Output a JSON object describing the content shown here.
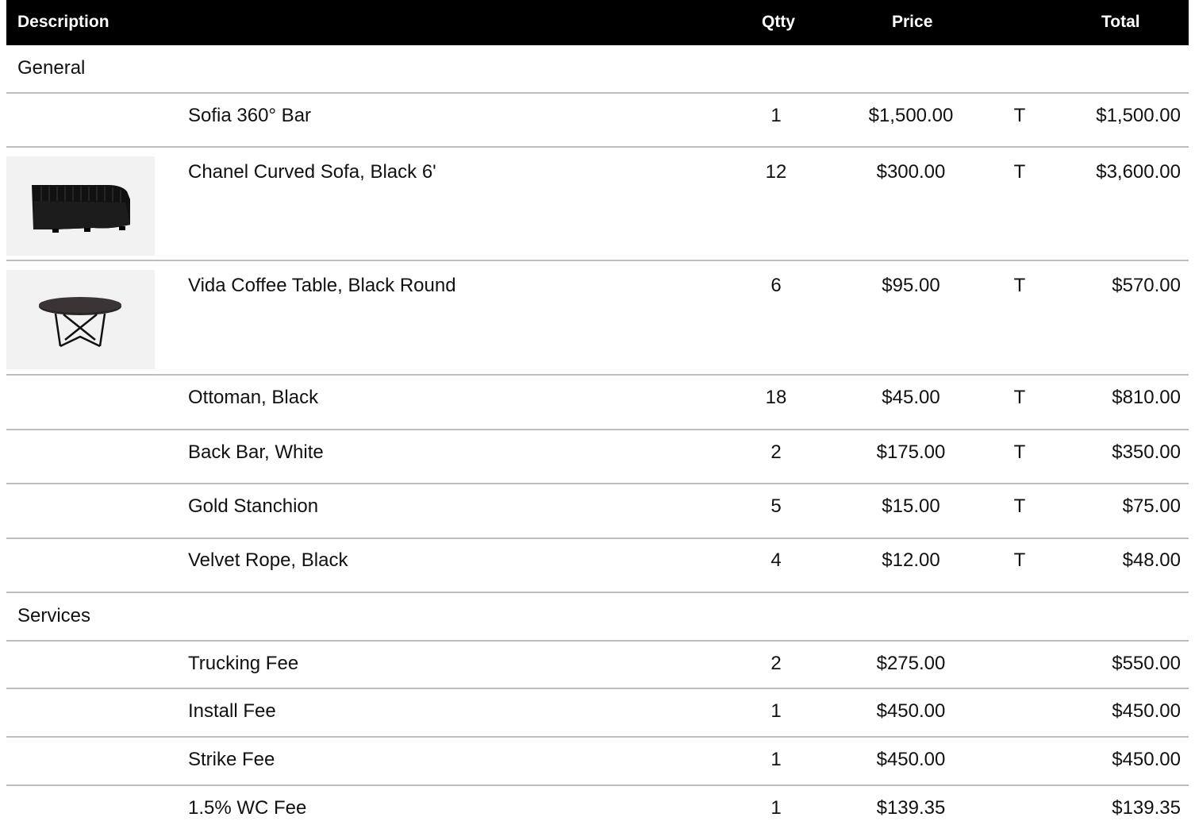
{
  "header": {
    "description": "Description",
    "qty": "Qtty",
    "price": "Price",
    "total": "Total"
  },
  "sections": {
    "general": "General",
    "services": "Services"
  },
  "general_items": [
    {
      "description": "Sofia 360° Bar",
      "qty": "1",
      "price": "$1,500.00",
      "tax": "T",
      "total": "$1,500.00",
      "image": null
    },
    {
      "description": "Chanel Curved Sofa, Black 6'",
      "qty": "12",
      "price": "$300.00",
      "tax": "T",
      "total": "$3,600.00",
      "image": "sofa-icon"
    },
    {
      "description": "Vida Coffee Table, Black Round",
      "qty": "6",
      "price": "$95.00",
      "tax": "T",
      "total": "$570.00",
      "image": "table-icon"
    },
    {
      "description": "Ottoman, Black",
      "qty": "18",
      "price": "$45.00",
      "tax": "T",
      "total": "$810.00",
      "image": null
    },
    {
      "description": "Back Bar, White",
      "qty": "2",
      "price": "$175.00",
      "tax": "T",
      "total": "$350.00",
      "image": null
    },
    {
      "description": "Gold Stanchion",
      "qty": "5",
      "price": "$15.00",
      "tax": "T",
      "total": "$75.00",
      "image": null
    },
    {
      "description": "Velvet Rope, Black",
      "qty": "4",
      "price": "$12.00",
      "tax": "T",
      "total": "$48.00",
      "image": null
    }
  ],
  "service_items": [
    {
      "description": "Trucking Fee",
      "qty": "2",
      "price": "$275.00",
      "tax": "",
      "total": "$550.00"
    },
    {
      "description": "Install Fee",
      "qty": "1",
      "price": "$450.00",
      "tax": "",
      "total": "$450.00"
    },
    {
      "description": "Strike Fee",
      "qty": "1",
      "price": "$450.00",
      "tax": "",
      "total": "$450.00"
    },
    {
      "description": "1.5% WC Fee",
      "qty": "1",
      "price": "$139.35",
      "tax": "",
      "total": "$139.35"
    }
  ]
}
